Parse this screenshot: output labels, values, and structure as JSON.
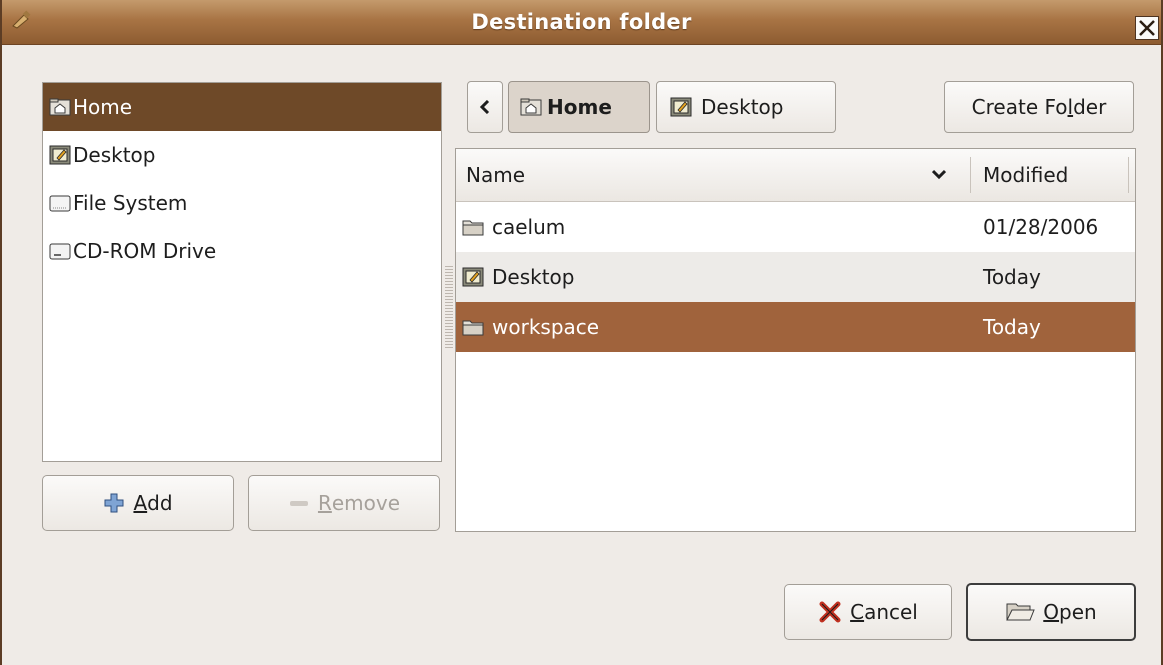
{
  "window": {
    "title": "Destination folder",
    "accent_color": "#a0633c",
    "selection_color": "#6e4928"
  },
  "places": [
    {
      "label": "Home",
      "icon": "home-folder-icon",
      "selected": true
    },
    {
      "label": "Desktop",
      "icon": "desktop-icon",
      "selected": false
    },
    {
      "label": "File System",
      "icon": "drive-icon",
      "selected": false
    },
    {
      "label": "CD-ROM Drive",
      "icon": "cdrom-drive-icon",
      "selected": false
    }
  ],
  "places_buttons": {
    "add_prefix": "",
    "add_mnemonic": "A",
    "add_rest": "dd",
    "remove_mnemonic": "R",
    "remove_rest": "emove"
  },
  "pathbar": {
    "back_icon": "chevron-left-icon",
    "crumbs": [
      "Home",
      "Desktop"
    ],
    "create_folder_pre": "Create Fo",
    "create_folder_mnemonic": "l",
    "create_folder_post": "der"
  },
  "file_list": {
    "columns": {
      "name": "Name",
      "modified": "Modified"
    },
    "rows": [
      {
        "name": "caelum",
        "modified": "01/28/2006",
        "icon": "folder-icon"
      },
      {
        "name": "Desktop",
        "modified": "Today",
        "icon": "desktop-icon"
      },
      {
        "name": "workspace",
        "modified": "Today",
        "icon": "folder-icon",
        "selected": true
      }
    ]
  },
  "dialog_buttons": {
    "cancel_mnemonic": "C",
    "cancel_rest": "ancel",
    "open_mnemonic": "O",
    "open_rest": "pen"
  }
}
